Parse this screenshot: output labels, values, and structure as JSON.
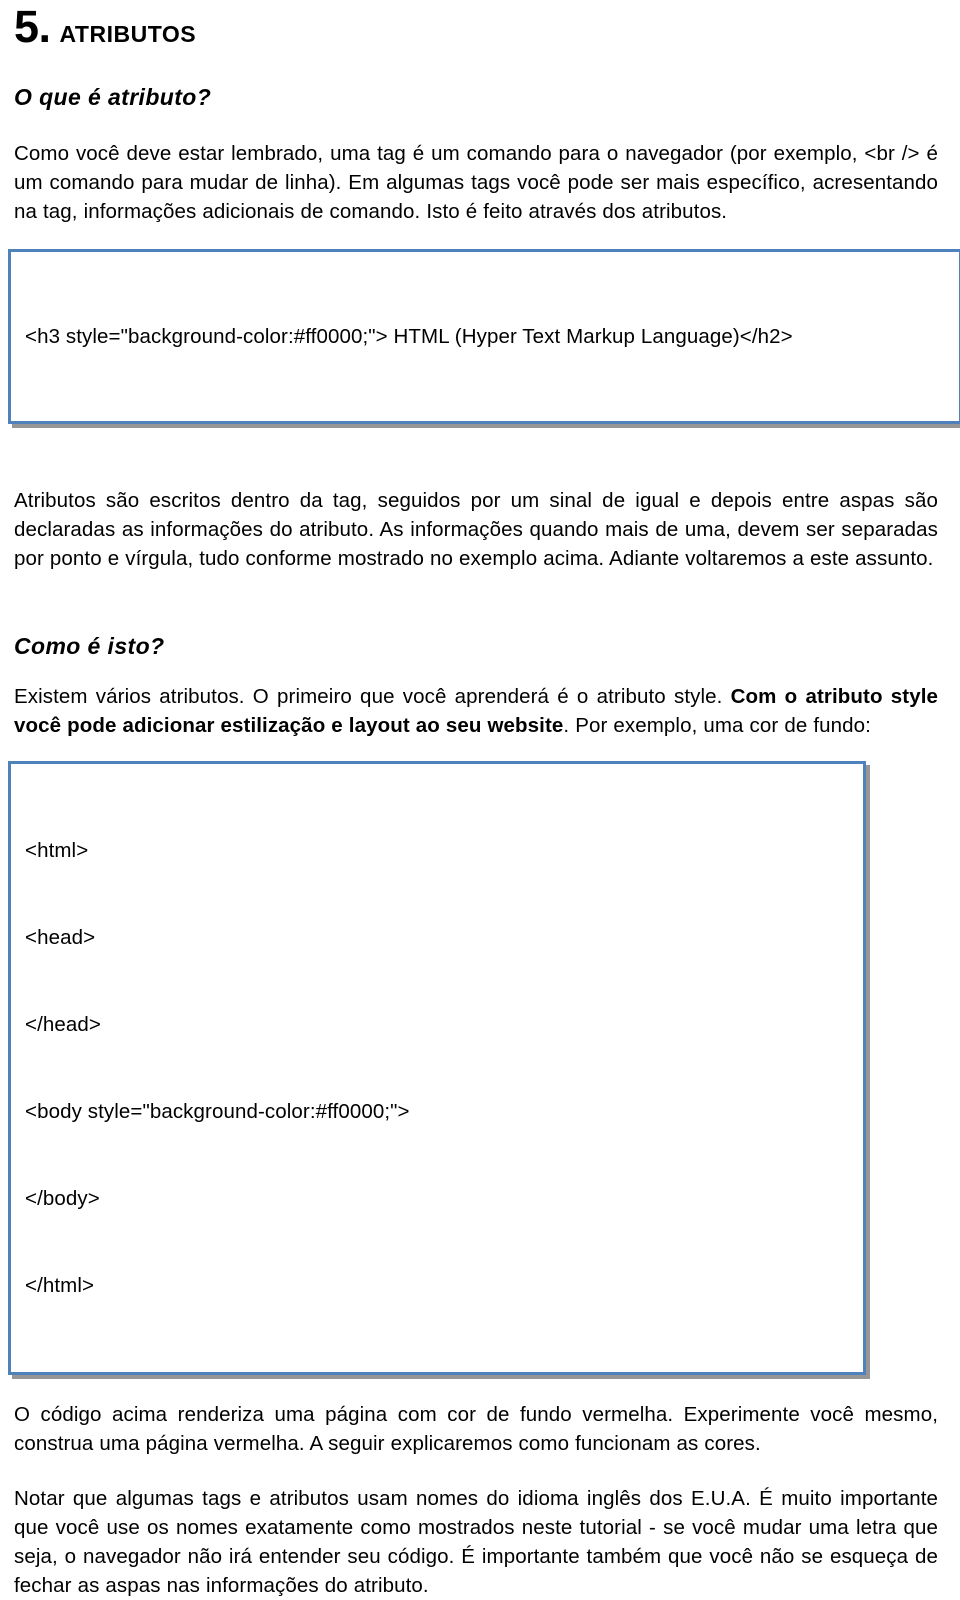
{
  "heading": {
    "number": "5.",
    "title": "ATRIBUTOS"
  },
  "sections": {
    "sub_heading_1": "O que é atributo?",
    "sub_heading_2": "Como é isto?"
  },
  "paragraphs": {
    "intro": "Como você deve estar lembrado, uma tag é um comando para o navegador (por exemplo, <br /> é um comando para mudar de linha). Em algumas tags você pode ser mais específico, acresentando na tag, informações adicionais de comando. Isto é feito através dos atributos.",
    "after_code_1": "Atributos são escritos dentro da tag, seguidos por um sinal de igual e depois entre aspas são declaradas as informações do atributo. As informações quando mais de uma, devem ser separadas por ponto e vírgula, tudo conforme mostrado no exemplo acima. Adiante voltaremos a este assunto.",
    "style_intro_part1": "Existem vários atributos. O primeiro que você aprenderá é o atributo style. ",
    "style_intro_bold": "Com o atributo style você pode adicionar estilização e layout ao seu website",
    "style_intro_part2": ". Por exemplo, uma cor de fundo:",
    "after_code_2": "O código acima renderiza uma página com cor de fundo vermelha. Experimente você mesmo, construa uma página vermelha. A seguir explicaremos como funcionam as cores.",
    "final": "Notar que algumas tags e atributos usam nomes do idioma inglês dos E.U.A. É muito importante que você use os nomes exatamente como mostrados neste tutorial - se você mudar uma letra que seja, o navegador não irá entender seu código. É importante também que você não se esqueça de fechar as aspas nas informações do atributo."
  },
  "code_block_1": {
    "line_1": "<h3 style=\"background-color:#ff0000;\"> HTML (Hyper Text Markup Language)</h2>"
  },
  "code_block_2": {
    "line_1": "<html>",
    "line_2": "<head>",
    "line_3": "</head>",
    "line_4": "<body style=\"background-color:#ff0000;\">",
    "line_5": "</body>",
    "line_6": "</html>"
  },
  "colors": {
    "code_border": "#4f81bd",
    "code_shadow": "#969696",
    "text": "#000000",
    "page_background": "#ffffff"
  }
}
